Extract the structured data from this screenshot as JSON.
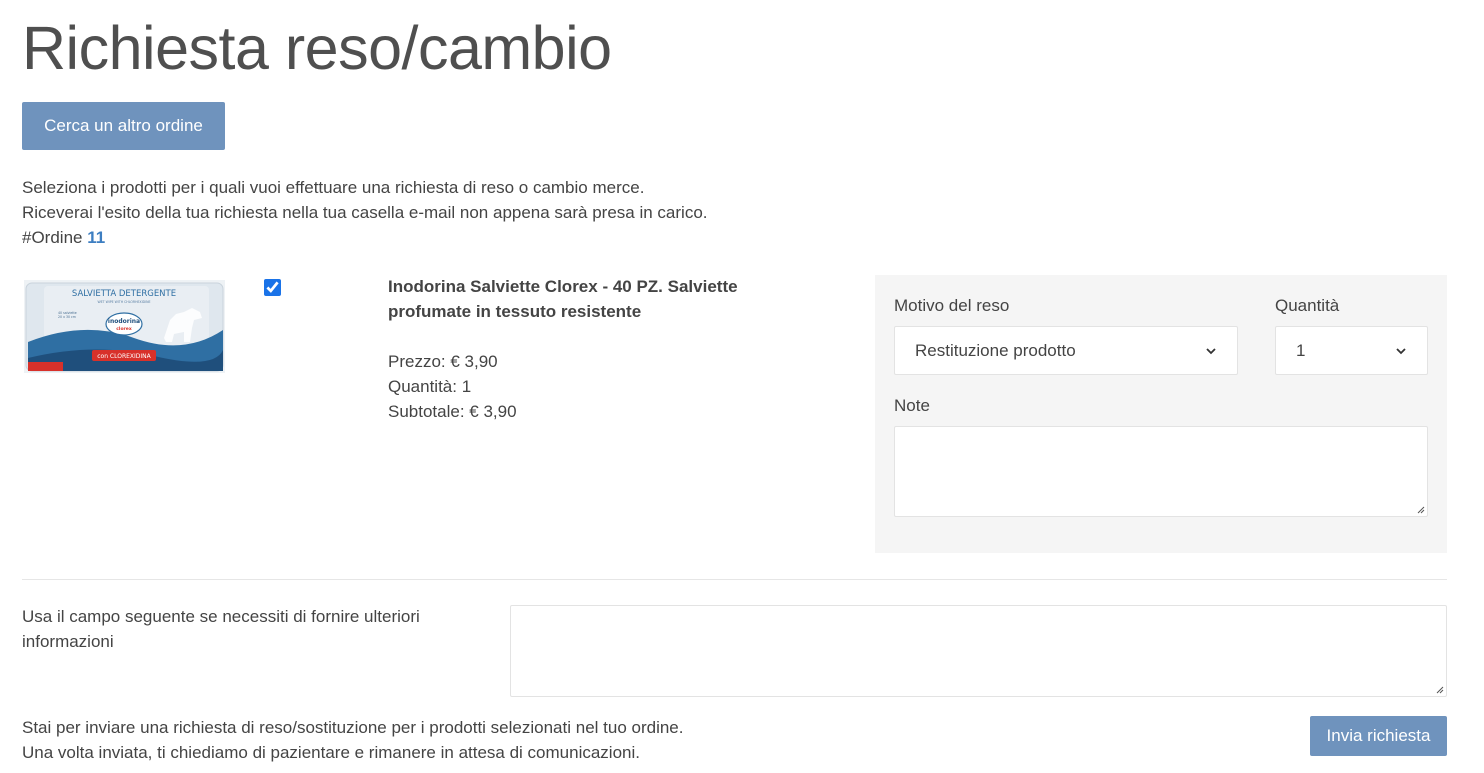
{
  "page": {
    "title": "Richiesta reso/cambio",
    "search_other_order_label": "Cerca un altro ordine"
  },
  "intro": {
    "line1": "Seleziona i prodotti per i quali vuoi effettuare una richiesta di reso o cambio merce.",
    "line2": "Riceverai l'esito della tua richiesta nella tua casella e-mail non appena sarà presa in carico.",
    "order_prefix": "#Ordine",
    "order_number": "11"
  },
  "product": {
    "selected": true,
    "name": "Inodorina Salviette Clorex - 40 PZ. Salviette profumate in tessuto resistente",
    "price": "Prezzo: € 3,90",
    "quantity": "Quantità: 1",
    "subtotal": "Subtotale: € 3,90",
    "image_text": {
      "banner": "SALVIETTA DETERGENTE",
      "sub": "WET WIPE WITH CHLORHEXIDINE",
      "brand": "inodorina",
      "product": "clorex",
      "badge": "con CLOREXIDINA",
      "count_line1": "40 salviette",
      "count_line2": "20 x 30 cm"
    },
    "colors": {
      "package_blue": "#2f6fa3",
      "package_red": "#d8312a",
      "package_light": "#dfe7ee"
    }
  },
  "return_form": {
    "reason_label": "Motivo del reso",
    "reason_value": "Restituzione prodotto",
    "quantity_label": "Quantità",
    "quantity_value": "1",
    "notes_label": "Note",
    "notes_value": ""
  },
  "extra": {
    "label": "Usa il campo seguente se necessiti di fornire ulteriori informazioni",
    "value": ""
  },
  "footer": {
    "line1": "Stai per inviare una richiesta di reso/sostituzione per i prodotti selezionati nel tuo ordine.",
    "line2": "Una volta inviata, ti chiediamo di pazientare e rimanere in attesa di comunicazioni.",
    "submit_label": "Invia richiesta"
  },
  "theme": {
    "button_color": "#6f93bd",
    "link_color": "#3d7ec1",
    "panel_bg": "#f5f5f5"
  }
}
